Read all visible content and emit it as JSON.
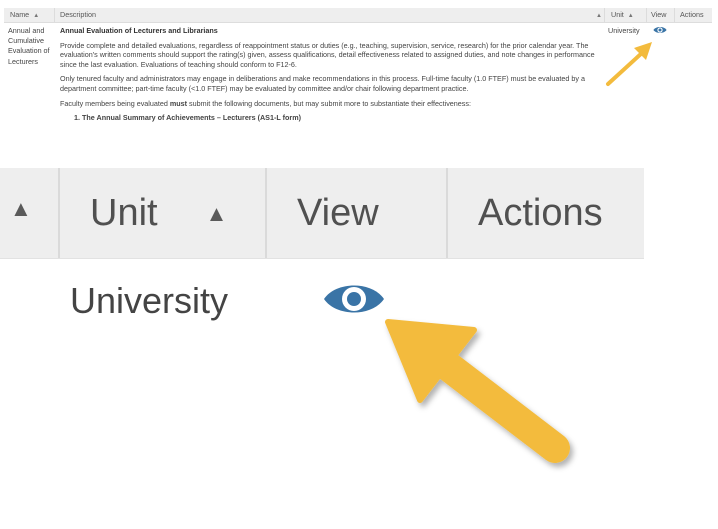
{
  "mini_table": {
    "headers": {
      "name": "Name",
      "description": "Description",
      "unit": "Unit",
      "view": "View",
      "actions": "Actions"
    },
    "row": {
      "name": "Annual and Cumulative Evaluation of Lecturers",
      "title": "Annual Evaluation of Lecturers and Librarians",
      "para1": "Provide complete and detailed evaluations, regardless of reappointment status or duties (e.g., teaching, supervision, service, research) for the prior calendar year. The evaluation's written comments should support the rating(s) given, assess qualifications, detail effectiveness related to assigned duties, and note changes in performance since the last evaluation. Evaluations of teaching should conform to F12-6.",
      "para2": "Only tenured faculty and administrators may engage in deliberations and make recommendations in this process. Full-time faculty (1.0 FTEF) must be evaluated by a department committee; part-time faculty (<1.0 FTEF) may be evaluated by committee and/or chair following department practice.",
      "para3_before": "Faculty members being evaluated ",
      "para3_bold": "must",
      "para3_after": " submit the following documents, but may submit more to substantiate their effectiveness:",
      "cut_item": "1. The Annual Summary of Achievements – Lecturers (AS1-L form)",
      "unit": "University",
      "view_icon": "eye-icon"
    }
  },
  "zoom": {
    "headers": {
      "unit": "Unit",
      "view": "View",
      "actions": "Actions"
    },
    "unit_value": "University",
    "view_icon": "eye-icon"
  },
  "colors": {
    "eye": "#3a74a6",
    "arrow": "#f3bb3d",
    "header_bg": "#eeeeee"
  }
}
